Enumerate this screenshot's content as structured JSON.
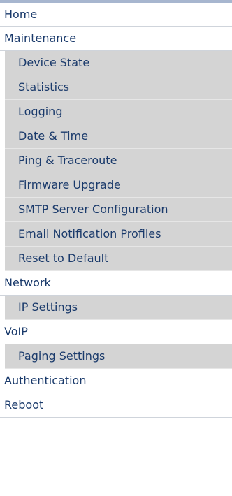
{
  "menu": {
    "home": "Home",
    "maintenance": "Maintenance",
    "maintenance_items": [
      "Device State",
      "Statistics",
      "Logging",
      "Date & Time",
      "Ping & Traceroute",
      "Firmware Upgrade",
      "SMTP Server Configuration",
      "Email Notification Profiles",
      "Reset to Default"
    ],
    "network": "Network",
    "network_items": [
      "IP Settings"
    ],
    "voip": "VoIP",
    "voip_items": [
      "Paging Settings"
    ],
    "authentication": "Authentication",
    "reboot": "Reboot"
  },
  "colors": {
    "link_text": "#1a3a6b",
    "submenu_background": "#d4d4d4",
    "top_border": "#a7b6cf"
  }
}
